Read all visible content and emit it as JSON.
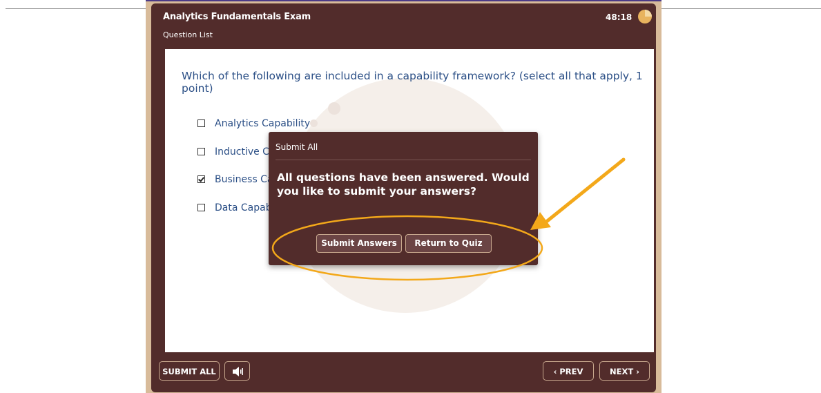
{
  "quiz": {
    "title": "Analytics Fundamentals Exam",
    "question_list_label": "Question List",
    "timer": "48:18"
  },
  "question": {
    "text": "Which of the following are included in a capability framework? (select all that apply, 1 point)",
    "choices": [
      {
        "label": "Analytics Capability",
        "checked": false
      },
      {
        "label": "Inductive Capability",
        "checked": false
      },
      {
        "label": "Business Capability",
        "checked": true
      },
      {
        "label": "Data Capability",
        "checked": false
      }
    ]
  },
  "dialog": {
    "title": "Submit All",
    "message": "All questions have been answered. Would you like to submit your answers?",
    "submit_label": "Submit Answers",
    "return_label": "Return to Quiz"
  },
  "footer": {
    "submit_all_label": "SUBMIT ALL",
    "prev_label": "PREV",
    "next_label": "NEXT"
  },
  "colors": {
    "frame": "#522c2b",
    "border": "#d8bb9a",
    "question_text": "#2b4f86",
    "annotation": "#f3a81a"
  }
}
